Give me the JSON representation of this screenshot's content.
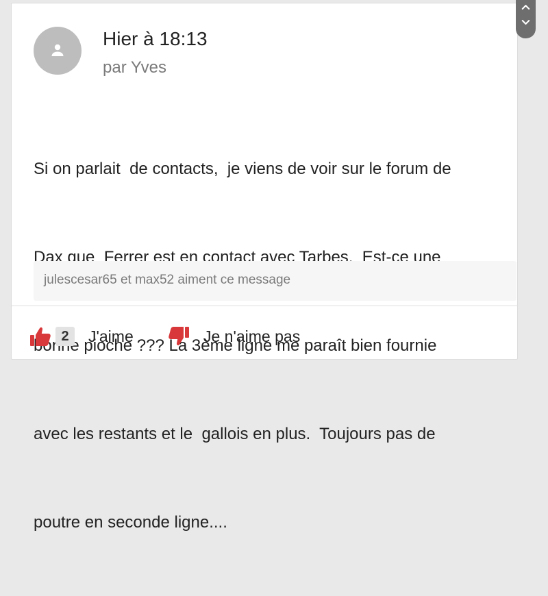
{
  "post": {
    "time": "Hier à 18:13",
    "author": "par Yves",
    "message_lines": [
      "Si on parlait  de contacts,  je viens de voir sur le forum de",
      "Dax que  Ferrer est en contact avec Tarbes.  Est-ce une",
      "bonne pioche ??? La 3ème ligne me paraît bien fournie",
      "avec les restants et le  gallois en plus.  Toujours pas de",
      "poutre en seconde ligne...."
    ],
    "likers": "julescesar65 et max52 aiment ce message"
  },
  "reactions": {
    "like_count": "2",
    "like_label": "J'aime",
    "dislike_label": "Je n'aime pas"
  },
  "icons": {
    "avatar": "user-placeholder-icon",
    "like": "thumbs-up-icon",
    "dislike": "thumbs-down-icon",
    "scroll_up": "chevron-up-icon",
    "scroll_down": "chevron-down-icon"
  },
  "colors": {
    "reaction_accent": "#d9383a",
    "avatar_bg": "#bdbdbd",
    "scroll_control_bg": "#6e6e6e"
  }
}
